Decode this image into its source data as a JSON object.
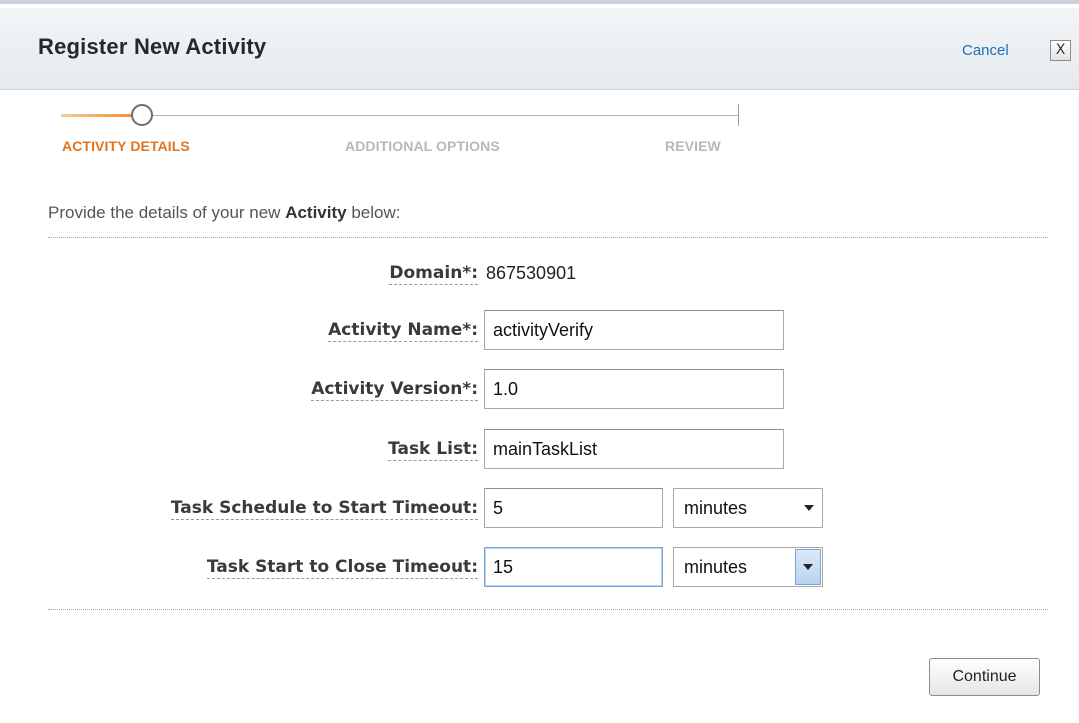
{
  "dialog": {
    "title": "Register New Activity",
    "cancel_label": "Cancel",
    "close_glyph": "X"
  },
  "wizard": {
    "steps": [
      {
        "label": "ACTIVITY DETAILS",
        "state": "active"
      },
      {
        "label": "ADDITIONAL OPTIONS",
        "state": "pending"
      },
      {
        "label": "REVIEW",
        "state": "pending"
      }
    ],
    "accent_color": "#e2741d"
  },
  "intro": {
    "prefix": "Provide the details of your new ",
    "bold": "Activity",
    "suffix": " below:"
  },
  "form": {
    "domain": {
      "label": "Domain*",
      "value": "867530901"
    },
    "activity_name": {
      "label": "Activity Name*",
      "value": "activityVerify"
    },
    "activity_version": {
      "label": "Activity Version*",
      "value": "1.0"
    },
    "task_list": {
      "label": "Task List",
      "value": "mainTaskList"
    },
    "schedule_to_start": {
      "label": "Task Schedule to Start Timeout",
      "value": "5",
      "unit": "minutes"
    },
    "start_to_close": {
      "label": "Task Start to Close Timeout",
      "value": "15",
      "unit": "minutes"
    }
  },
  "footer": {
    "continue_label": "Continue"
  }
}
